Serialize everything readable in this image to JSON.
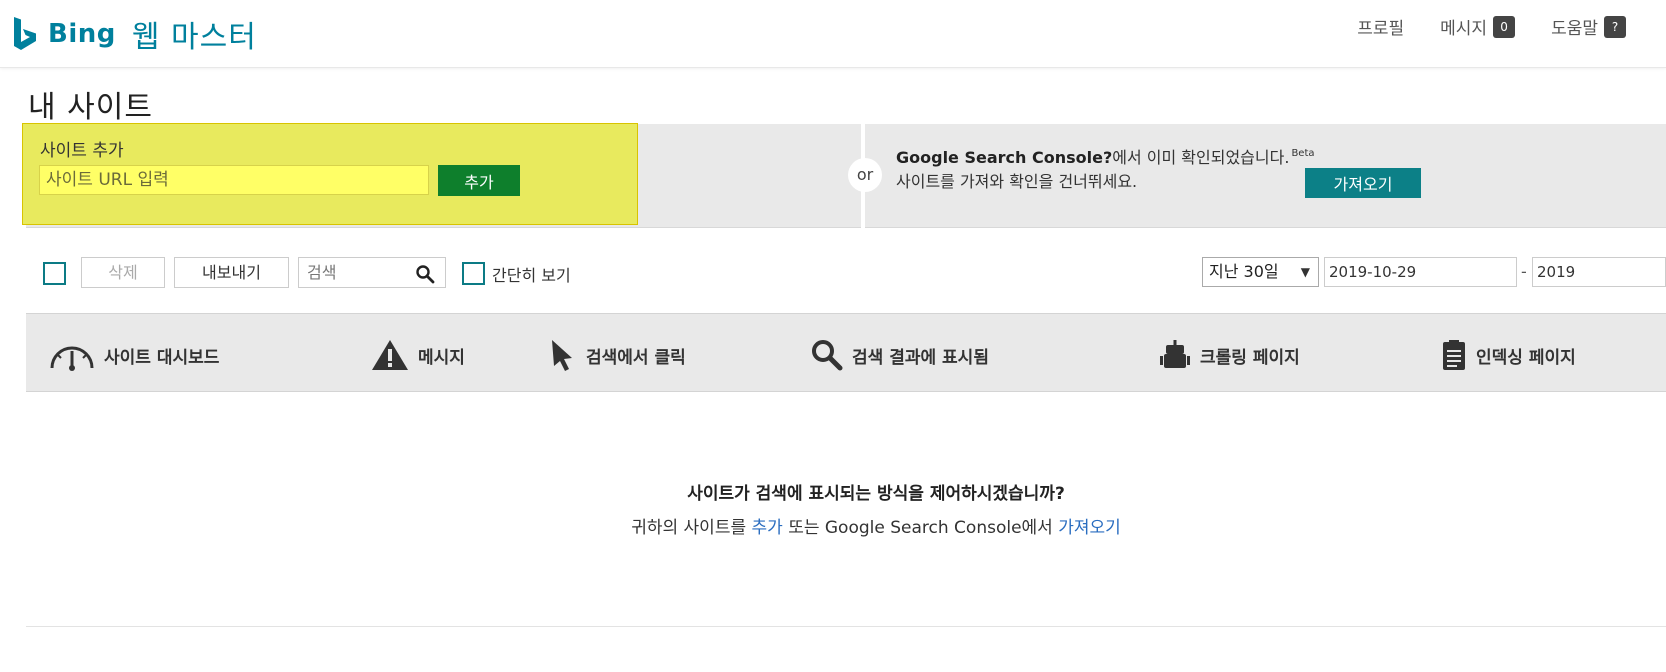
{
  "header": {
    "brand": "Bing",
    "product": "웹 마스터",
    "nav": {
      "profile": "프로필",
      "messages": "메시지",
      "messages_count": "0",
      "help": "도움말",
      "help_badge": "?"
    }
  },
  "page": {
    "title": "내 사이트"
  },
  "add_site": {
    "label": "사이트 추가",
    "placeholder": "사이트 URL 입력",
    "button": "추가"
  },
  "or_label": "or",
  "gsc": {
    "title": "Google Search Console?",
    "title_rest": "에서 이미 확인되었습니다.",
    "beta": "Beta",
    "line2": "사이트를 가져와 확인을 건너뛰세요.",
    "button": "가져오기"
  },
  "toolbar": {
    "delete": "삭제",
    "export": "내보내기",
    "search_placeholder": "검색",
    "compact_view": "간단히 보기",
    "range": "지난 30일",
    "date_from": "2019-10-29",
    "date_to": "2019",
    "date_sep": "-"
  },
  "tabs": [
    {
      "label": "사이트 대시보드",
      "icon": "gauge-icon"
    },
    {
      "label": "메시지",
      "icon": "warning-icon"
    },
    {
      "label": "검색에서 클릭",
      "icon": "cursor-icon"
    },
    {
      "label": "검색 결과에 표시됨",
      "icon": "search-icon"
    },
    {
      "label": "크롤링 페이지",
      "icon": "robot-icon"
    },
    {
      "label": "인덱싱 페이지",
      "icon": "clipboard-icon"
    }
  ],
  "empty_state": {
    "title": "사이트가 검색에 표시되는 방식을 제어하시겠습니까?",
    "prefix": "귀하의 사이트를 ",
    "link_add": "추가",
    "middle": " 또는 Google Search Console에서 ",
    "link_import": "가져오기"
  },
  "colors": {
    "brand": "#00809d",
    "highlight": "#e8ea5e",
    "add_button": "#0e7f2c",
    "import_button": "#0c8087",
    "link": "#2a6dc0"
  }
}
